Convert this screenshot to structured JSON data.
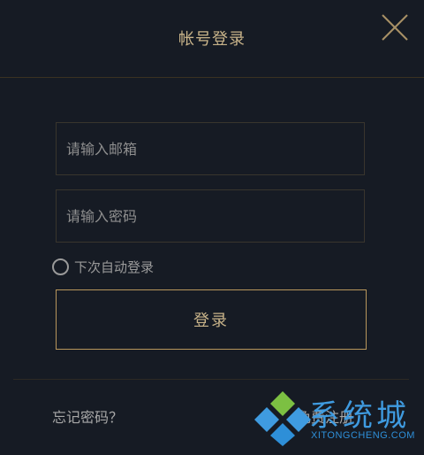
{
  "dialog": {
    "title": "帐号登录",
    "close_icon": "close-icon",
    "email_placeholder": "请输入邮箱",
    "password_placeholder": "请输入密码",
    "remember_label": "下次自动登录",
    "login_label": "登录",
    "forgot_label": "忘记密码？",
    "register_label": "免费注册"
  },
  "watermark": {
    "text_cn": "系统城",
    "text_en": "XITONGCHENG.COM",
    "logo_icon": "diamond-logo-icon"
  },
  "colors": {
    "background": "#161b24",
    "accent_gold": "#c9b48a",
    "button_border": "#b8965c",
    "text_gray": "#9a9a9a",
    "watermark_blue": "#3f9be0",
    "watermark_green": "#7cc042"
  }
}
